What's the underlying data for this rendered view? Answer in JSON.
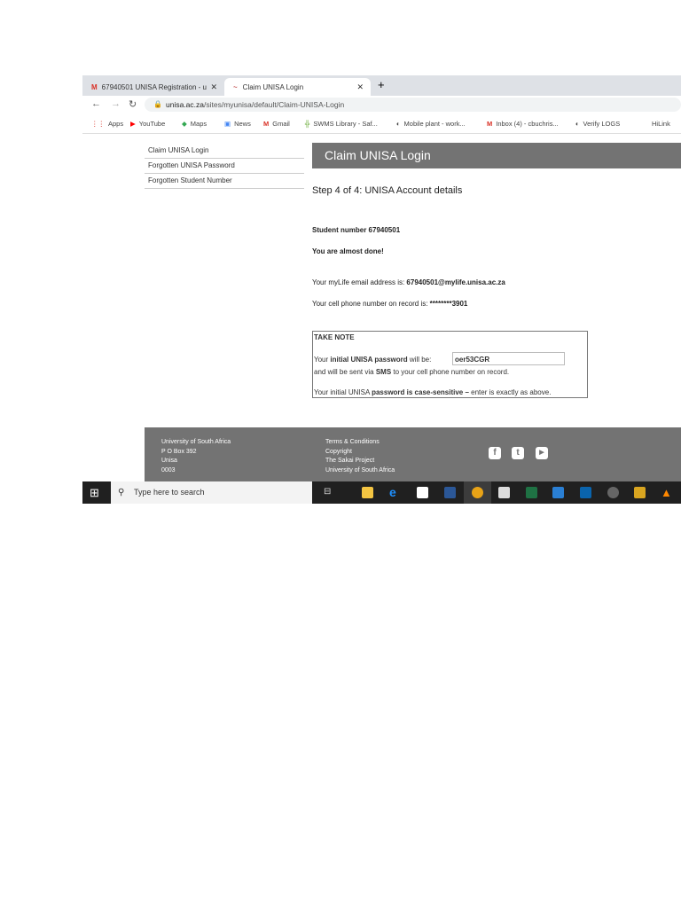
{
  "browser": {
    "tabs": [
      {
        "label": "67940501 UNISA Registration - u"
      },
      {
        "label": "Claim UNISA Login"
      }
    ],
    "url_domain": "unisa.ac.za",
    "url_path": "/sites/myunisa/default/Claim-UNISA-Login",
    "bookmarks": [
      "Apps",
      "YouTube",
      "Maps",
      "News",
      "Gmail",
      "SWMS Library - Saf...",
      "Mobile plant - work...",
      "Inbox (4) - cbuchris...",
      "Verify LOGS",
      "HiLink"
    ]
  },
  "sidebar": {
    "items": [
      "Claim UNISA Login",
      "Forgotten UNISA Password",
      "Forgotten Student Number"
    ]
  },
  "main": {
    "title": "Claim UNISA Login",
    "step": "Step 4 of 4: UNISA Account details",
    "student_number": "Student number 67940501",
    "almost_done": "You are almost done!",
    "email_label": "Your myLife email address is: ",
    "email": "67940501@mylife.unisa.ac.za",
    "phone_label": "Your cell phone number on record is: ",
    "phone": "********3901",
    "note": {
      "title": "TAKE NOTE",
      "pw_pre": "Your ",
      "pw_bold": "initial UNISA password",
      "pw_post": " will be:",
      "password": "oer53CGR",
      "sms_pre": "and will be sent via ",
      "sms_bold": "SMS",
      "sms_post": " to your cell phone number on record.",
      "cs_pre": "Your initial UNISA ",
      "cs_bold": "password is case-sensitive –",
      "cs_post": " enter is exactly as above."
    }
  },
  "footer": {
    "address": [
      "University of South Africa",
      "P O Box 392",
      "Unisa",
      "0003"
    ],
    "links": [
      "Terms & Conditions",
      "Copyright",
      "The Sakai Project",
      "University of South Africa"
    ]
  },
  "taskbar": {
    "search_placeholder": "Type here to search"
  }
}
